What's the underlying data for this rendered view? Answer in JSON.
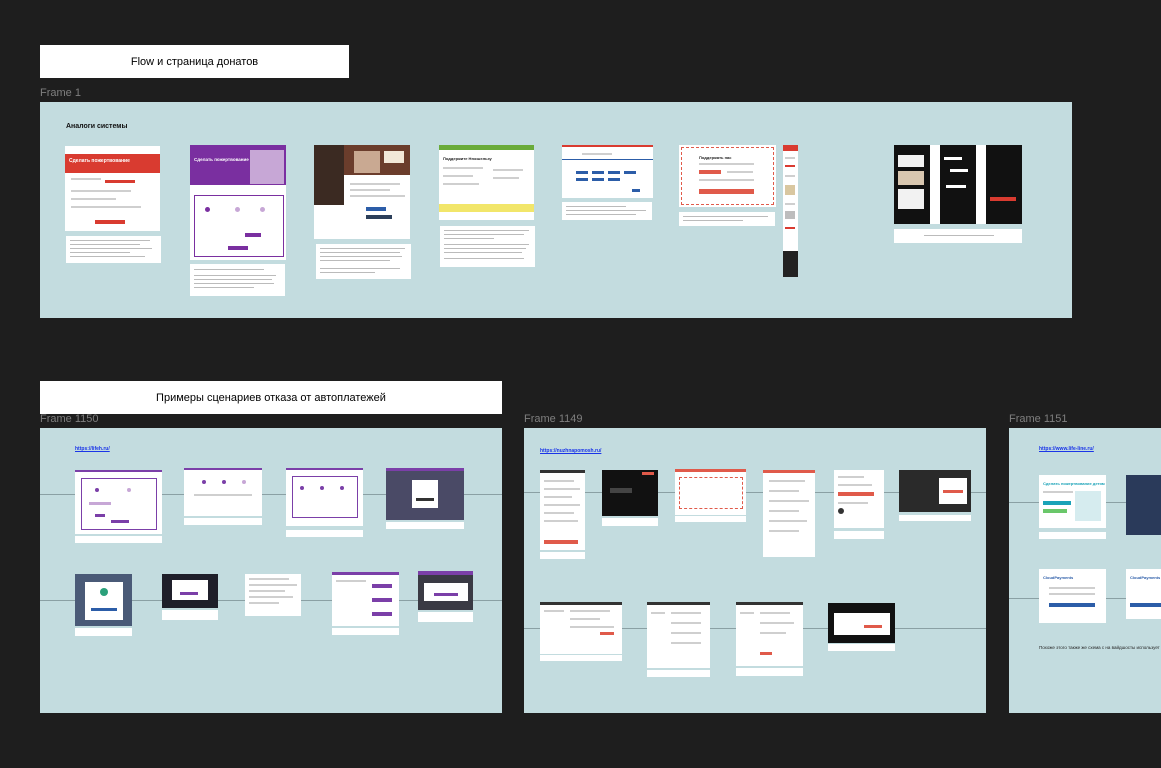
{
  "sections": {
    "donate_title": "Flow и страница донатов",
    "autopay_title": "Примеры сценариев отказа от автоплатежей"
  },
  "frames": {
    "frame1": {
      "label": "Frame 1",
      "heading": "Аналоги системы",
      "tiles": [
        {
          "name": "analog-1",
          "hero_text": "Сделать пожертвование",
          "accent": "#d93b30"
        },
        {
          "name": "analog-2",
          "hero_text": "Сделать пожертвование",
          "accent": "#7a2fa0"
        },
        {
          "name": "analog-3",
          "hero_text": "",
          "accent": "#6b3d2c"
        },
        {
          "name": "analog-4",
          "hero_text": "Поддержите Нюсшельзу",
          "accent": "#6aab3a"
        },
        {
          "name": "analog-5",
          "hero_text": "",
          "accent": "#2c5da8"
        },
        {
          "name": "analog-6",
          "hero_text": "Поддержать нас",
          "accent": "#e05a4a"
        },
        {
          "name": "analog-7",
          "hero_text": "",
          "accent": "#d93b30"
        },
        {
          "name": "analog-8",
          "hero_text": "",
          "accent": "#111111"
        }
      ]
    },
    "frame1150": {
      "label": "Frame 1150",
      "link": "https://lifeh.ru/",
      "accent": "#7b3fa8"
    },
    "frame1149": {
      "label": "Frame 1149",
      "link": "https://nuzhnapomosh.ru/",
      "accent": "#e05a4a"
    },
    "frame1151": {
      "label": "Frame 1151",
      "link": "https://www.life-line.ru/",
      "hero_text": "Сделать пожертвование детям",
      "cloud_text": "CloudPayments",
      "note": "Похоже этого также же схема с на вайдшосты использует"
    }
  },
  "colors": {
    "canvas": "#1e1e1e",
    "frame_bg": "#c3dcdf",
    "label": "#7f7f7f"
  }
}
